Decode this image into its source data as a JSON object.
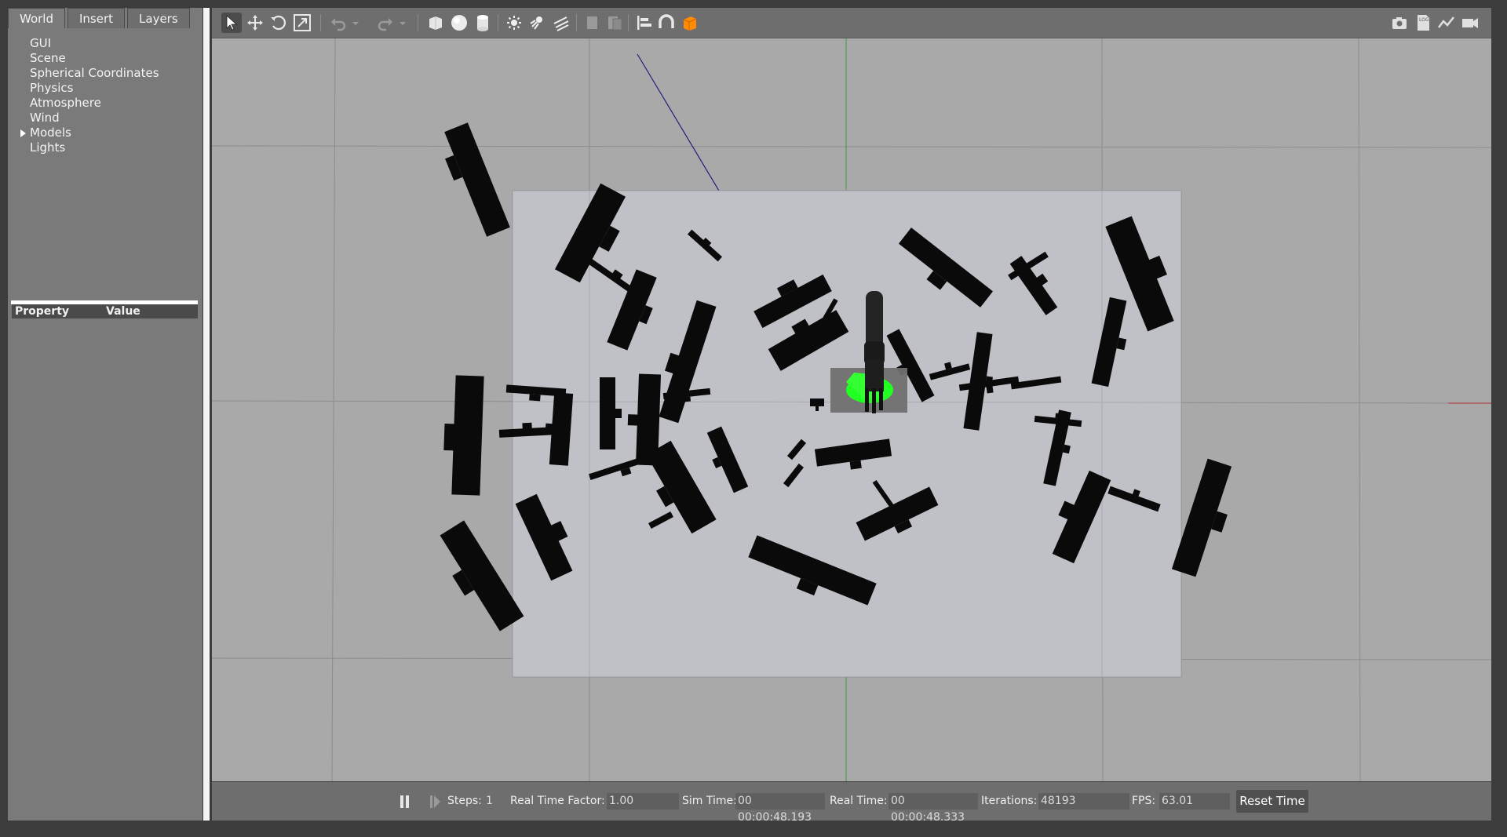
{
  "tabs": [
    "World",
    "Insert",
    "Layers"
  ],
  "world_tree": [
    {
      "label": "GUI",
      "expandable": false
    },
    {
      "label": "Scene",
      "expandable": false
    },
    {
      "label": "Spherical Coordinates",
      "expandable": false
    },
    {
      "label": "Physics",
      "expandable": false
    },
    {
      "label": "Atmosphere",
      "expandable": false
    },
    {
      "label": "Wind",
      "expandable": false
    },
    {
      "label": "Models",
      "expandable": true
    },
    {
      "label": "Lights",
      "expandable": false
    }
  ],
  "property_header": {
    "property": "Property",
    "value": "Value"
  },
  "toolbar": {
    "left_tools": [
      "select-mode-icon",
      "translate-mode-icon",
      "rotate-mode-icon",
      "scale-mode-icon",
      "undo-icon",
      "redo-icon",
      "box-shape-icon",
      "sphere-shape-icon",
      "cylinder-shape-icon",
      "point-light-icon",
      "spot-light-icon",
      "directional-light-icon",
      "copy-icon",
      "paste-icon",
      "align-icon",
      "snap-icon",
      "change-view-icon"
    ],
    "right_tools": [
      "screenshot-icon",
      "log-icon",
      "plot-icon",
      "video-record-icon"
    ]
  },
  "bottom_bar": {
    "steps_label": "Steps:",
    "steps_value": "1",
    "rtf_label": "Real Time Factor:",
    "rtf_value": "1.00",
    "sim_time_label": "Sim Time:",
    "sim_time_value": "00 00:00:48.193",
    "real_time_label": "Real Time:",
    "real_time_value": "00 00:00:48.333",
    "iterations_label": "Iterations:",
    "iterations_value": "48193",
    "fps_label": "FPS:",
    "fps_value": "63.01",
    "reset_label": "Reset Time"
  },
  "colors": {
    "panel": "#7a7a7a",
    "toolbar": "#6e6e6e",
    "viewport": "#a9a9a9",
    "ground_plane": "#c2c4ca",
    "highlight": "#22ff22",
    "accent": "#ff8c00"
  }
}
